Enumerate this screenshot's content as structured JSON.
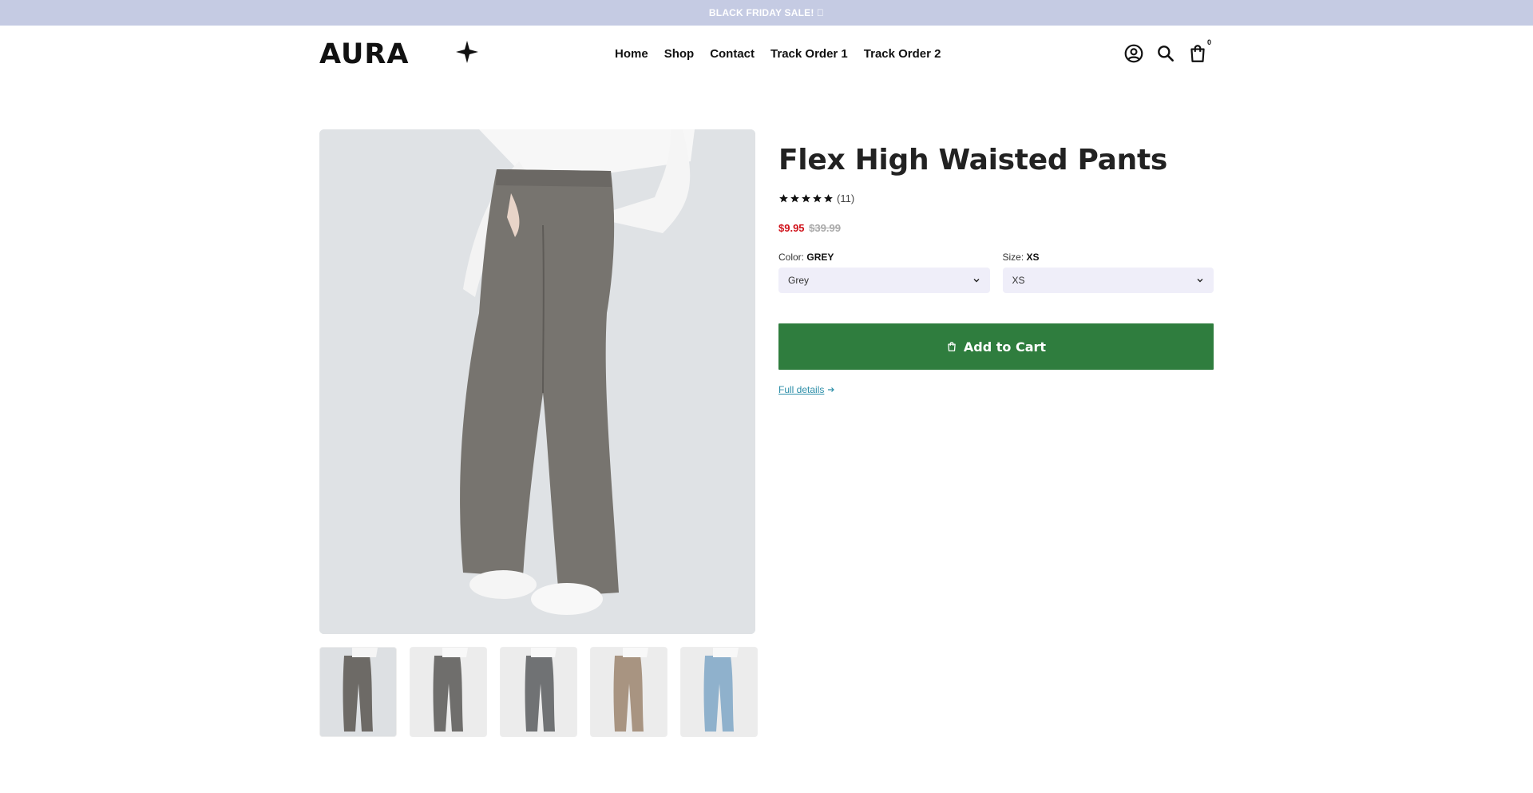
{
  "announcement": {
    "text": "BLACK FRIDAY SALE! ⃞"
  },
  "brand": {
    "name": "AURA"
  },
  "nav": {
    "items": [
      {
        "label": "Home"
      },
      {
        "label": "Shop"
      },
      {
        "label": "Contact"
      },
      {
        "label": "Track Order 1"
      },
      {
        "label": "Track Order 2"
      }
    ]
  },
  "header": {
    "icons": [
      "account-icon",
      "search-icon",
      "cart-icon"
    ],
    "cart_count": "0"
  },
  "product": {
    "title": "Flex High Waisted Pants",
    "rating_stars": 5,
    "review_count": "(11)",
    "price_sale": "$9.95",
    "price_original": "$39.99",
    "color_label": "Color:",
    "color_value": "GREY",
    "color_selected": "Grey",
    "size_label": "Size:",
    "size_value": "XS",
    "size_selected": "XS",
    "add_to_cart": "Add to Cart",
    "full_details": "Full details"
  },
  "gallery": {
    "thumbnail_colors": [
      "#6d6a66",
      "#6f6e6c",
      "#707274",
      "#a89481",
      "#8fb1cc"
    ]
  },
  "colors": {
    "announcement_bg": "#c5cbe3",
    "accent_green": "#2f7d3e",
    "sale_red": "#d0121a",
    "link_teal": "#2c8ea8"
  }
}
